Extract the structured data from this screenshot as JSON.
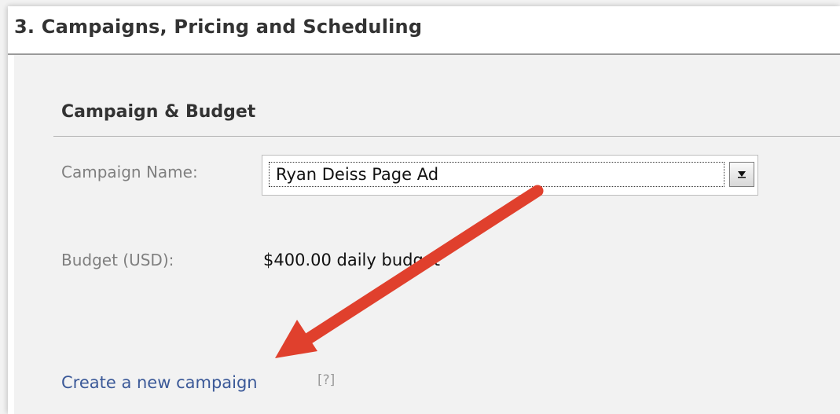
{
  "section": {
    "title": "3. Campaigns, Pricing and Scheduling"
  },
  "campaign_budget": {
    "title": "Campaign & Budget",
    "campaign_name_label": "Campaign Name:",
    "campaign_name_value": "Ryan Deiss Page Ad",
    "budget_label": "Budget (USD):",
    "budget_value": "$400.00 daily budget",
    "create_link": "Create a new campaign",
    "help_link": "[?]"
  },
  "icons": {
    "dropdown": "chevron-down-icon",
    "annotation": "red-arrow-icon"
  },
  "colors": {
    "link": "#3b5998",
    "annotation_arrow": "#e0402d",
    "panel_background": "#f2f2f2",
    "label": "#7f7f7f"
  }
}
